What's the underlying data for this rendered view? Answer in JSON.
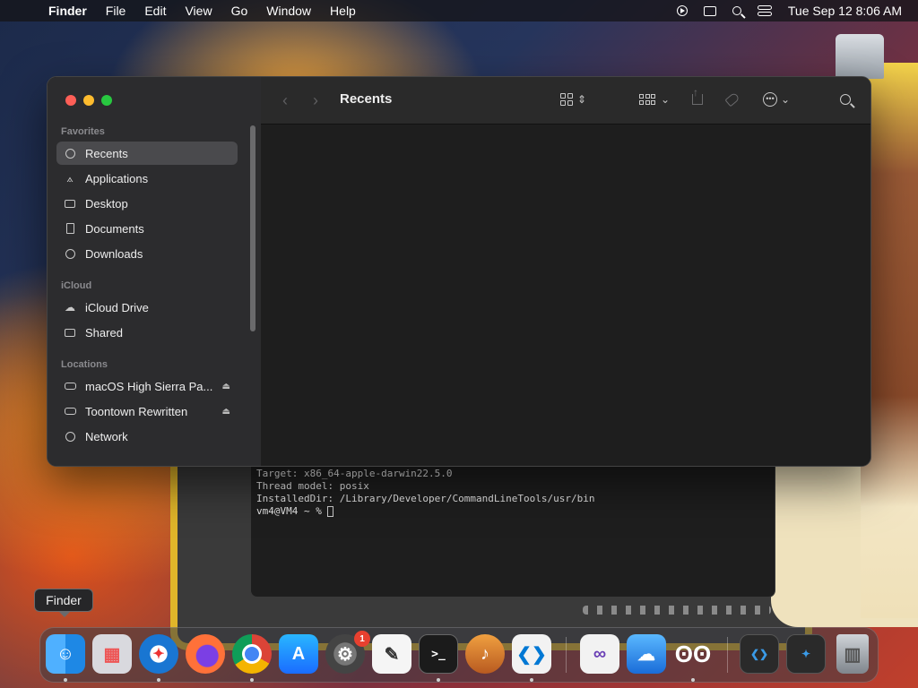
{
  "menubar": {
    "app_name": "Finder",
    "menus": [
      "File",
      "Edit",
      "View",
      "Go",
      "Window",
      "Help"
    ],
    "clock": "Tue Sep 12  8:06 AM"
  },
  "finder": {
    "title": "Recents",
    "sections": {
      "favorites": "Favorites",
      "icloud": "iCloud",
      "locations": "Locations"
    },
    "favorites": [
      "Recents",
      "Applications",
      "Desktop",
      "Documents",
      "Downloads"
    ],
    "icloud": [
      "iCloud Drive",
      "Shared"
    ],
    "locations": [
      "macOS High Sierra Pa...",
      "Toontown Rewritten",
      "Network"
    ],
    "eject_glyph": "⏏"
  },
  "terminal": {
    "lines": [
      "Target: x86_64-apple-darwin22.5.0",
      "Thread model: posix",
      "InstalledDir: /Library/Developer/CommandLineTools/usr/bin",
      "vm4@VM4 ~ % "
    ]
  },
  "dock": {
    "tooltip": "Finder",
    "settings_badge": "1",
    "colors": {
      "finder": "#1e88e5",
      "safari": "#1976d2",
      "firefox": "#ff7139",
      "chrome": "#ffffff",
      "appstore": "#1a8cff",
      "vscode": "#0078d4",
      "visualstudio": "#6a3fb5"
    }
  }
}
